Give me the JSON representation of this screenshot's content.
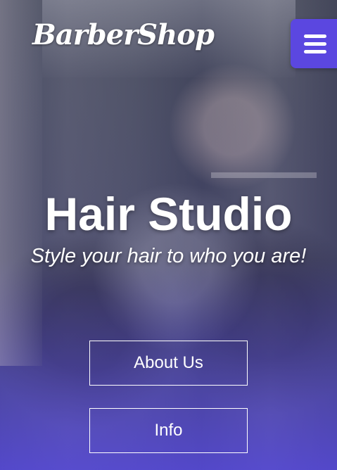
{
  "header": {
    "logo_text": "BarberShop",
    "menu_icon": "hamburger-menu-icon"
  },
  "hero": {
    "title": "Hair Studio",
    "subtitle": "Style your hair to who you are!"
  },
  "buttons": {
    "about_label": "About Us",
    "info_label": "Info"
  },
  "colors": {
    "accent": "#5b47e0",
    "text": "#ffffff"
  }
}
